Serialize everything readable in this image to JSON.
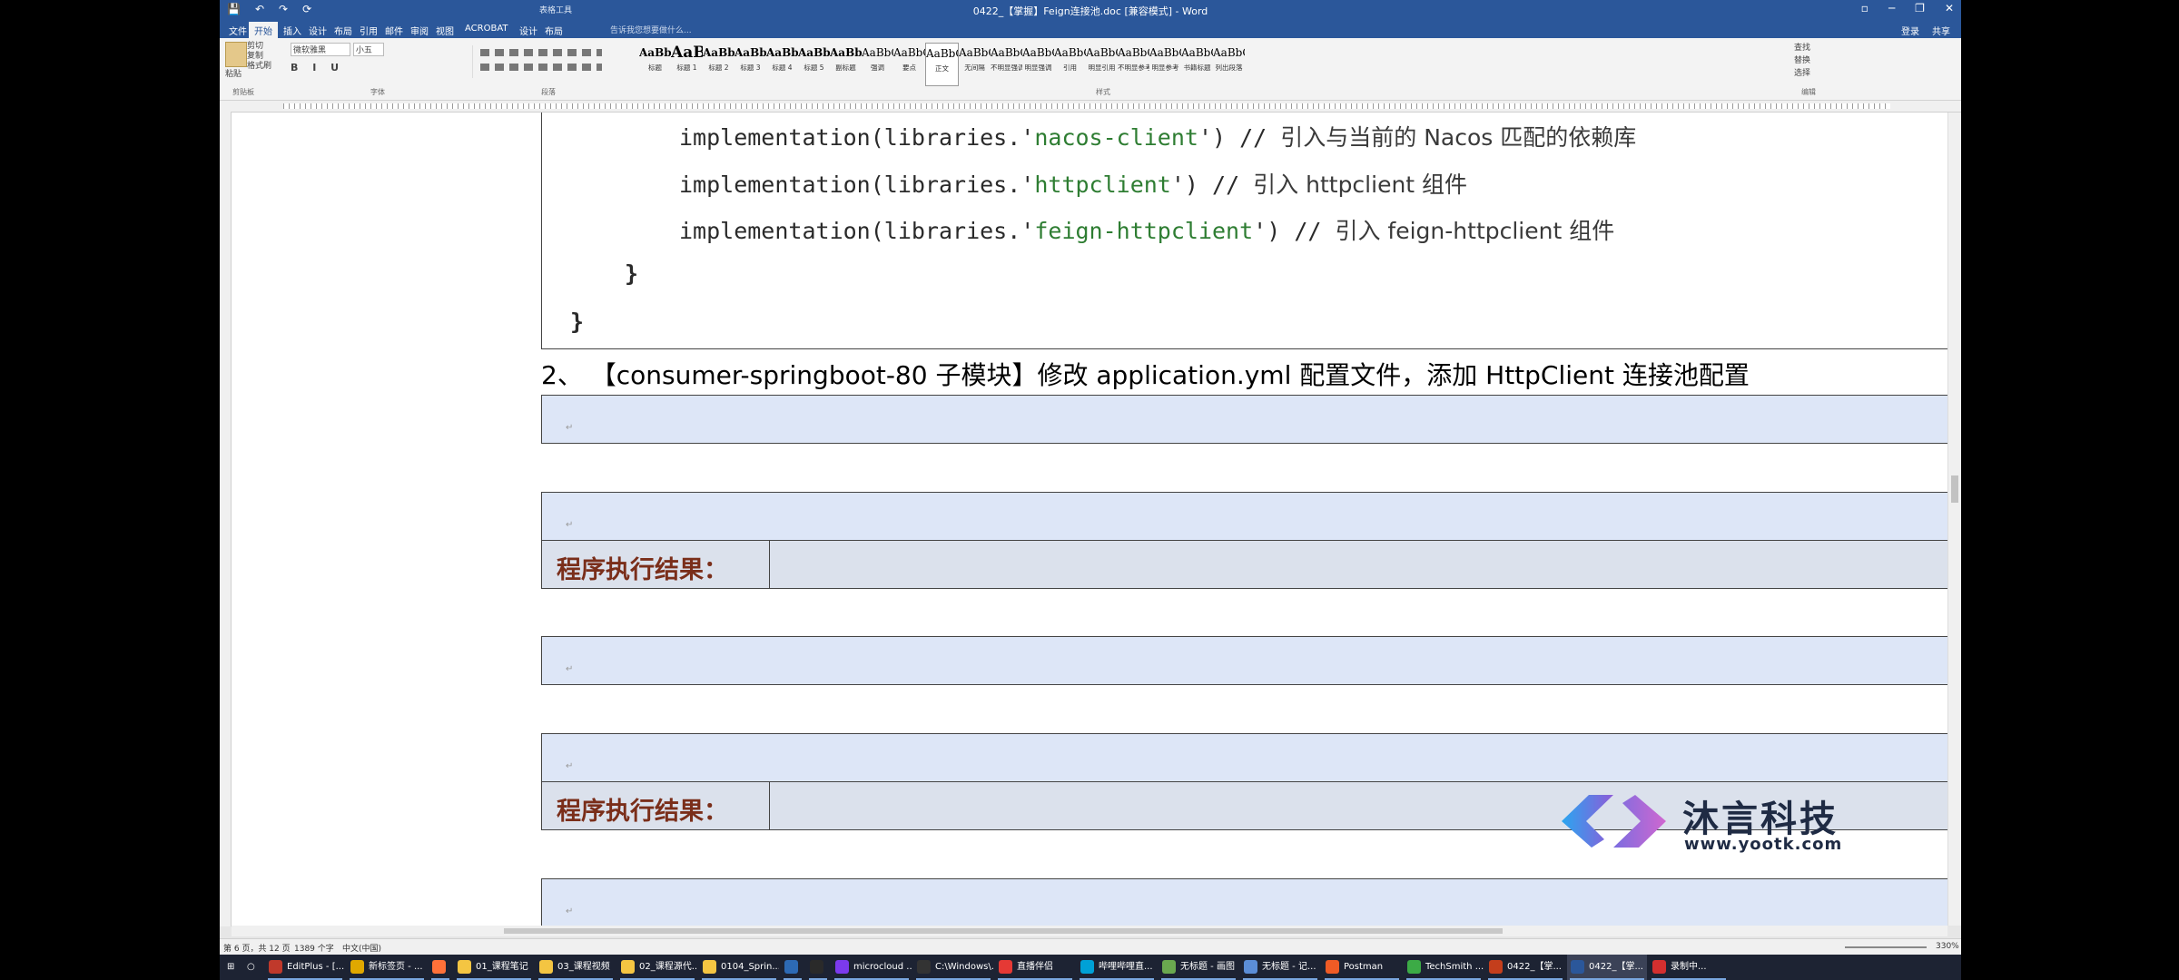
{
  "titlebar": {
    "title": "0422_【掌握】Feign连接池.doc [兼容模式] - Word",
    "context_tab": "表格工具",
    "qat": [
      "💾",
      "↶",
      "↷",
      "⟳"
    ],
    "window_buttons": [
      "▫",
      "─",
      "❐",
      "✕"
    ]
  },
  "tabs": [
    "文件",
    "开始",
    "插入",
    "设计",
    "布局",
    "引用",
    "邮件",
    "审阅",
    "视图",
    "ACROBAT",
    "设计",
    "布局"
  ],
  "active_tab": "开始",
  "tell_me": "告诉我您想要做什么...",
  "account": {
    "signin": "登录",
    "share": "共享"
  },
  "ribbon": {
    "clipboard": {
      "paste": "粘贴",
      "cut": "剪切",
      "copy": "复制",
      "format_painter": "格式刷",
      "label": "剪贴板"
    },
    "font": {
      "name": "微软雅黑",
      "size": "小五",
      "label": "字体"
    },
    "paragraph": {
      "label": "段落"
    },
    "styles_label": "样式",
    "styles": [
      {
        "preview": "AaBbC",
        "name": "标题"
      },
      {
        "preview": "AaBl",
        "name": "标题 1"
      },
      {
        "preview": "AaBb(",
        "name": "标题 2"
      },
      {
        "preview": "AaBb(",
        "name": "标题 3"
      },
      {
        "preview": "AaBb(",
        "name": "标题 4"
      },
      {
        "preview": "AaBbC",
        "name": "标题 5"
      },
      {
        "preview": "AaBbC",
        "name": "副标题"
      },
      {
        "preview": "AaBbCcDt",
        "name": "强调"
      },
      {
        "preview": "AaBbCcD",
        "name": "要点"
      },
      {
        "preview": "AaBbCcDc",
        "name": "正文"
      },
      {
        "preview": "AaBbCcDc",
        "name": "无间隔"
      },
      {
        "preview": "AaBbCcDc",
        "name": "不明显强调"
      },
      {
        "preview": "AaBbCcDc",
        "name": "明显强调"
      },
      {
        "preview": "AaBbCcDc",
        "name": "引用"
      },
      {
        "preview": "AaBbCcDc",
        "name": "明显引用"
      },
      {
        "preview": "AaBbCcD",
        "name": "不明显参考"
      },
      {
        "preview": "AaBbCcI",
        "name": "明显参考"
      },
      {
        "preview": "AaBbCcD",
        "name": "书籍标题"
      },
      {
        "preview": "AaBbCcDc",
        "name": "列出段落"
      }
    ],
    "editing": {
      "find": "查找",
      "replace": "替换",
      "select": "选择",
      "label": "编辑"
    }
  },
  "code_lines": [
    {
      "pre": "implementation(libraries.'",
      "str": "nacos-client",
      "post": "') // ",
      "comment": "引入与当前的 Nacos 匹配的依赖库"
    },
    {
      "pre": "implementation(libraries.'",
      "str": "httpclient",
      "post": "') // ",
      "comment": "引入 httpclient 组件"
    },
    {
      "pre": "implementation(libraries.'",
      "str": "feign-httpclient",
      "post": "') // ",
      "comment": "引入 feign-httpclient 组件"
    }
  ],
  "brace_inner": "}",
  "brace_outer": "}",
  "heading": "2、 【consumer-springboot-80 子模块】修改 application.yml 配置文件，添加 HttpClient 连接池配置",
  "result_label": "程序执行结果：",
  "watermark": {
    "brand": "沐言科技",
    "url": "www.yootk.com"
  },
  "statusbar": {
    "page": "第 6 页，共 12 页",
    "words": "1389 个字",
    "lang": "中文(中国)",
    "zoom": "330%"
  },
  "taskbar": [
    {
      "label": "EditPlus - [...",
      "color": "#c0392b"
    },
    {
      "label": "新标签页 - ...",
      "color": "#e0a800"
    },
    {
      "label": "",
      "color": "#ff7139"
    },
    {
      "label": "01_课程笔记",
      "color": "#f4c542"
    },
    {
      "label": "03_课程视频",
      "color": "#f4c542"
    },
    {
      "label": "02_课程源代...",
      "color": "#f4c542"
    },
    {
      "label": "0104_Sprin...",
      "color": "#f4c542"
    },
    {
      "label": "",
      "color": "#2d6ab4"
    },
    {
      "label": "",
      "color": "#2a2a2a"
    },
    {
      "label": "microcloud ...",
      "color": "#7c3aed"
    },
    {
      "label": "C:\\Windows\\...",
      "color": "#333333"
    },
    {
      "label": "直播伴侣",
      "color": "#e53935"
    },
    {
      "label": "哔哩哔哩直...",
      "color": "#00a1d6"
    },
    {
      "label": "无标题 - 画图",
      "color": "#6aa84f"
    },
    {
      "label": "无标题 - 记...",
      "color": "#5b8dd6"
    },
    {
      "label": "Postman",
      "color": "#ef5b25"
    },
    {
      "label": "TechSmith ...",
      "color": "#3cab46"
    },
    {
      "label": "0422_【掌...",
      "color": "#c43e1c"
    },
    {
      "label": "0422_【掌...",
      "color": "#2b579a"
    },
    {
      "label": "录制中...",
      "color": "#d32f2f"
    }
  ],
  "colors": {
    "word_blue": "#2b579a",
    "table_fill": "#dde6f7",
    "label_red": "#7a2e1a",
    "code_string": "#2e7d32"
  }
}
